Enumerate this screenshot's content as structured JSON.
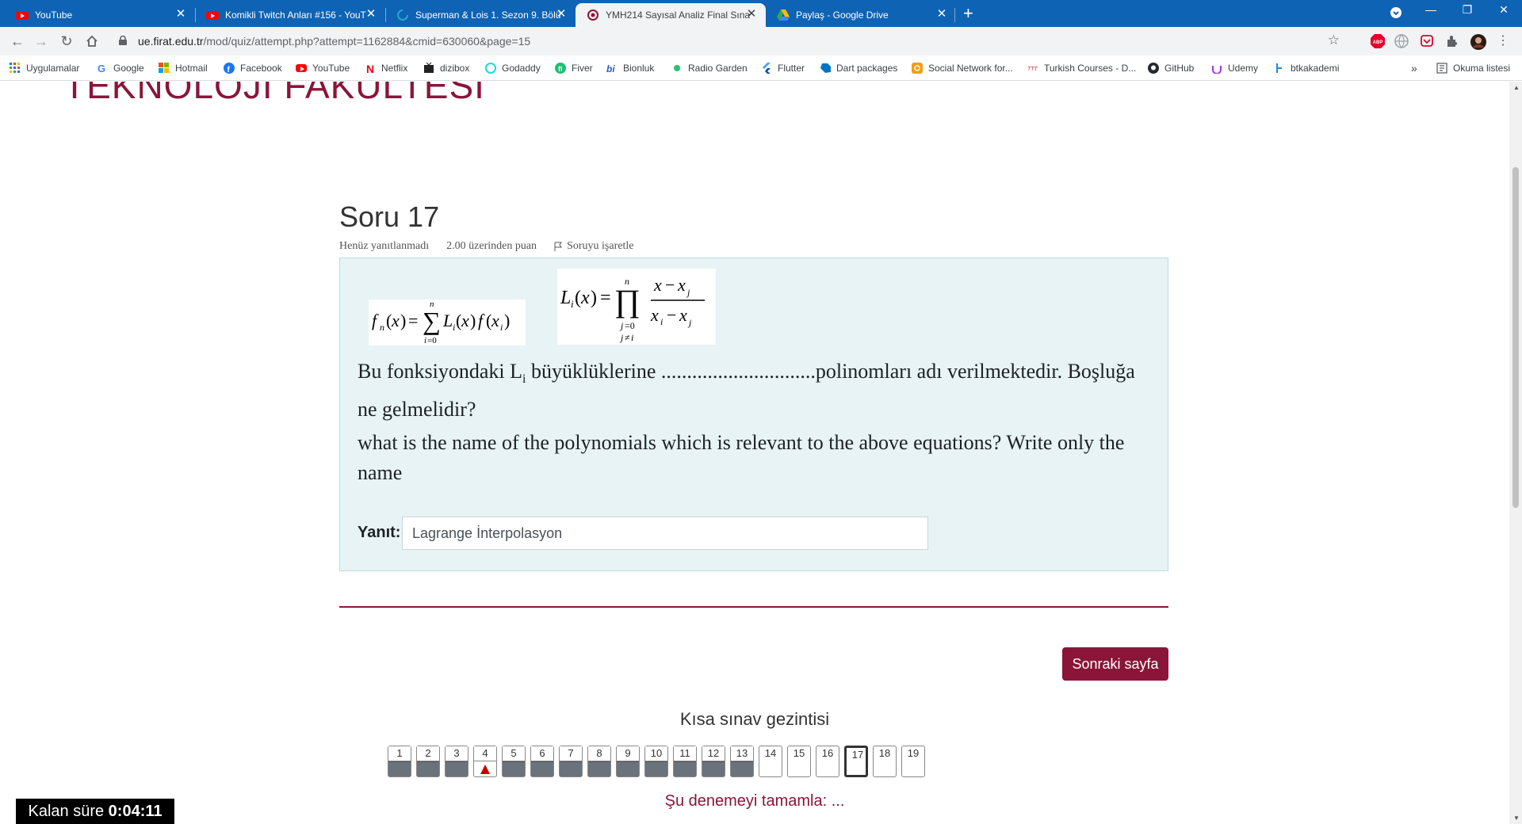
{
  "browser": {
    "tabs": [
      {
        "title": "YouTube",
        "icon": "youtube-icon"
      },
      {
        "title": "Komikli Twitch Anları #156 - YouT",
        "icon": "youtube-icon"
      },
      {
        "title": "Superman & Lois 1. Sezon 9. Bölü",
        "icon": "site-icon"
      },
      {
        "title": "YMH214 Sayısal Analiz Final Sına",
        "icon": "moodle-icon"
      },
      {
        "title": "Paylaş - Google Drive",
        "icon": "google-drive-icon"
      }
    ],
    "active_tab": 3,
    "url_host": "ue.firat.edu.tr",
    "url_path": "/mod/quiz/attempt.php?attempt=1162884&cmid=630060&page=15",
    "bookmarks": [
      {
        "label": "Uygulamalar",
        "icon": "apps-icon"
      },
      {
        "label": "Google",
        "icon": "google-icon"
      },
      {
        "label": "Hotmail",
        "icon": "microsoft-icon"
      },
      {
        "label": "Facebook",
        "icon": "facebook-icon"
      },
      {
        "label": "YouTube",
        "icon": "youtube-icon"
      },
      {
        "label": "Netflix",
        "icon": "netflix-icon"
      },
      {
        "label": "dizibox",
        "icon": "dizibox-icon"
      },
      {
        "label": "Godaddy",
        "icon": "godaddy-icon"
      },
      {
        "label": "Fiver",
        "icon": "fiverr-icon"
      },
      {
        "label": "Bionluk",
        "icon": "bionluk-icon"
      },
      {
        "label": "Radio Garden",
        "icon": "radio-garden-icon"
      },
      {
        "label": "Flutter",
        "icon": "flutter-icon"
      },
      {
        "label": "Dart packages",
        "icon": "dart-icon"
      },
      {
        "label": "Social Network for...",
        "icon": "social-network-icon"
      },
      {
        "label": "Turkish Courses - D...",
        "icon": "turkish-courses-icon"
      },
      {
        "label": "GitHub",
        "icon": "github-icon"
      },
      {
        "label": "Udemy",
        "icon": "udemy-icon"
      },
      {
        "label": "btkakademi",
        "icon": "btk-icon"
      }
    ],
    "more_bookmarks": "»",
    "reading_list": "Okuma listesi"
  },
  "page": {
    "faculty_banner": "TEKNOLOJİ FAKÜLTESİ",
    "question": {
      "title": "Soru 17",
      "status": "Henüz yanıtlanmadı",
      "points": "2.00 üzerinden puan",
      "flag_label": "Soruyu işaretle",
      "formula1": "f_n(x) = Σ_{i=0}^{n} L_i(x) f(x_i)",
      "formula2": "L_i(x) = Π_{j=0, j≠i}^{n} (x − x_j)/(x_i − x_j)",
      "text_tr_before": "Bu fonksiyondaki L",
      "text_tr_sub": "i",
      "text_tr_after": "  büyüklüklerine ..............................polinomları adı verilmektedir. Boşluğa ne gelmelidir?",
      "text_en": "what is the name of the polynomials which is relevant to the above equations? Write only the name",
      "answer_label": "Yanıt:",
      "answer_value": "Lagrange İnterpolasyon"
    },
    "next_button": "Sonraki sayfa",
    "nav_title": "Kısa sınav gezintisi",
    "nav_buttons": [
      {
        "n": "1",
        "state": "answered"
      },
      {
        "n": "2",
        "state": "answered"
      },
      {
        "n": "3",
        "state": "answered"
      },
      {
        "n": "4",
        "state": "flagged"
      },
      {
        "n": "5",
        "state": "answered"
      },
      {
        "n": "6",
        "state": "answered"
      },
      {
        "n": "7",
        "state": "answered"
      },
      {
        "n": "8",
        "state": "answered"
      },
      {
        "n": "9",
        "state": "answered"
      },
      {
        "n": "10",
        "state": "answered"
      },
      {
        "n": "11",
        "state": "answered"
      },
      {
        "n": "12",
        "state": "answered"
      },
      {
        "n": "13",
        "state": "answered"
      },
      {
        "n": "14",
        "state": "empty"
      },
      {
        "n": "15",
        "state": "empty"
      },
      {
        "n": "16",
        "state": "empty"
      },
      {
        "n": "17",
        "state": "current"
      },
      {
        "n": "18",
        "state": "empty"
      },
      {
        "n": "19",
        "state": "empty"
      }
    ],
    "finish_link": "Şu denemeyi tamamla: ...",
    "timer_label": "Kalan süre",
    "timer_value": "0:04:11"
  },
  "colors": {
    "brand": "#8a1538",
    "chrome_tabbar": "#0e63b4",
    "question_bg": "#e7f3f5"
  }
}
